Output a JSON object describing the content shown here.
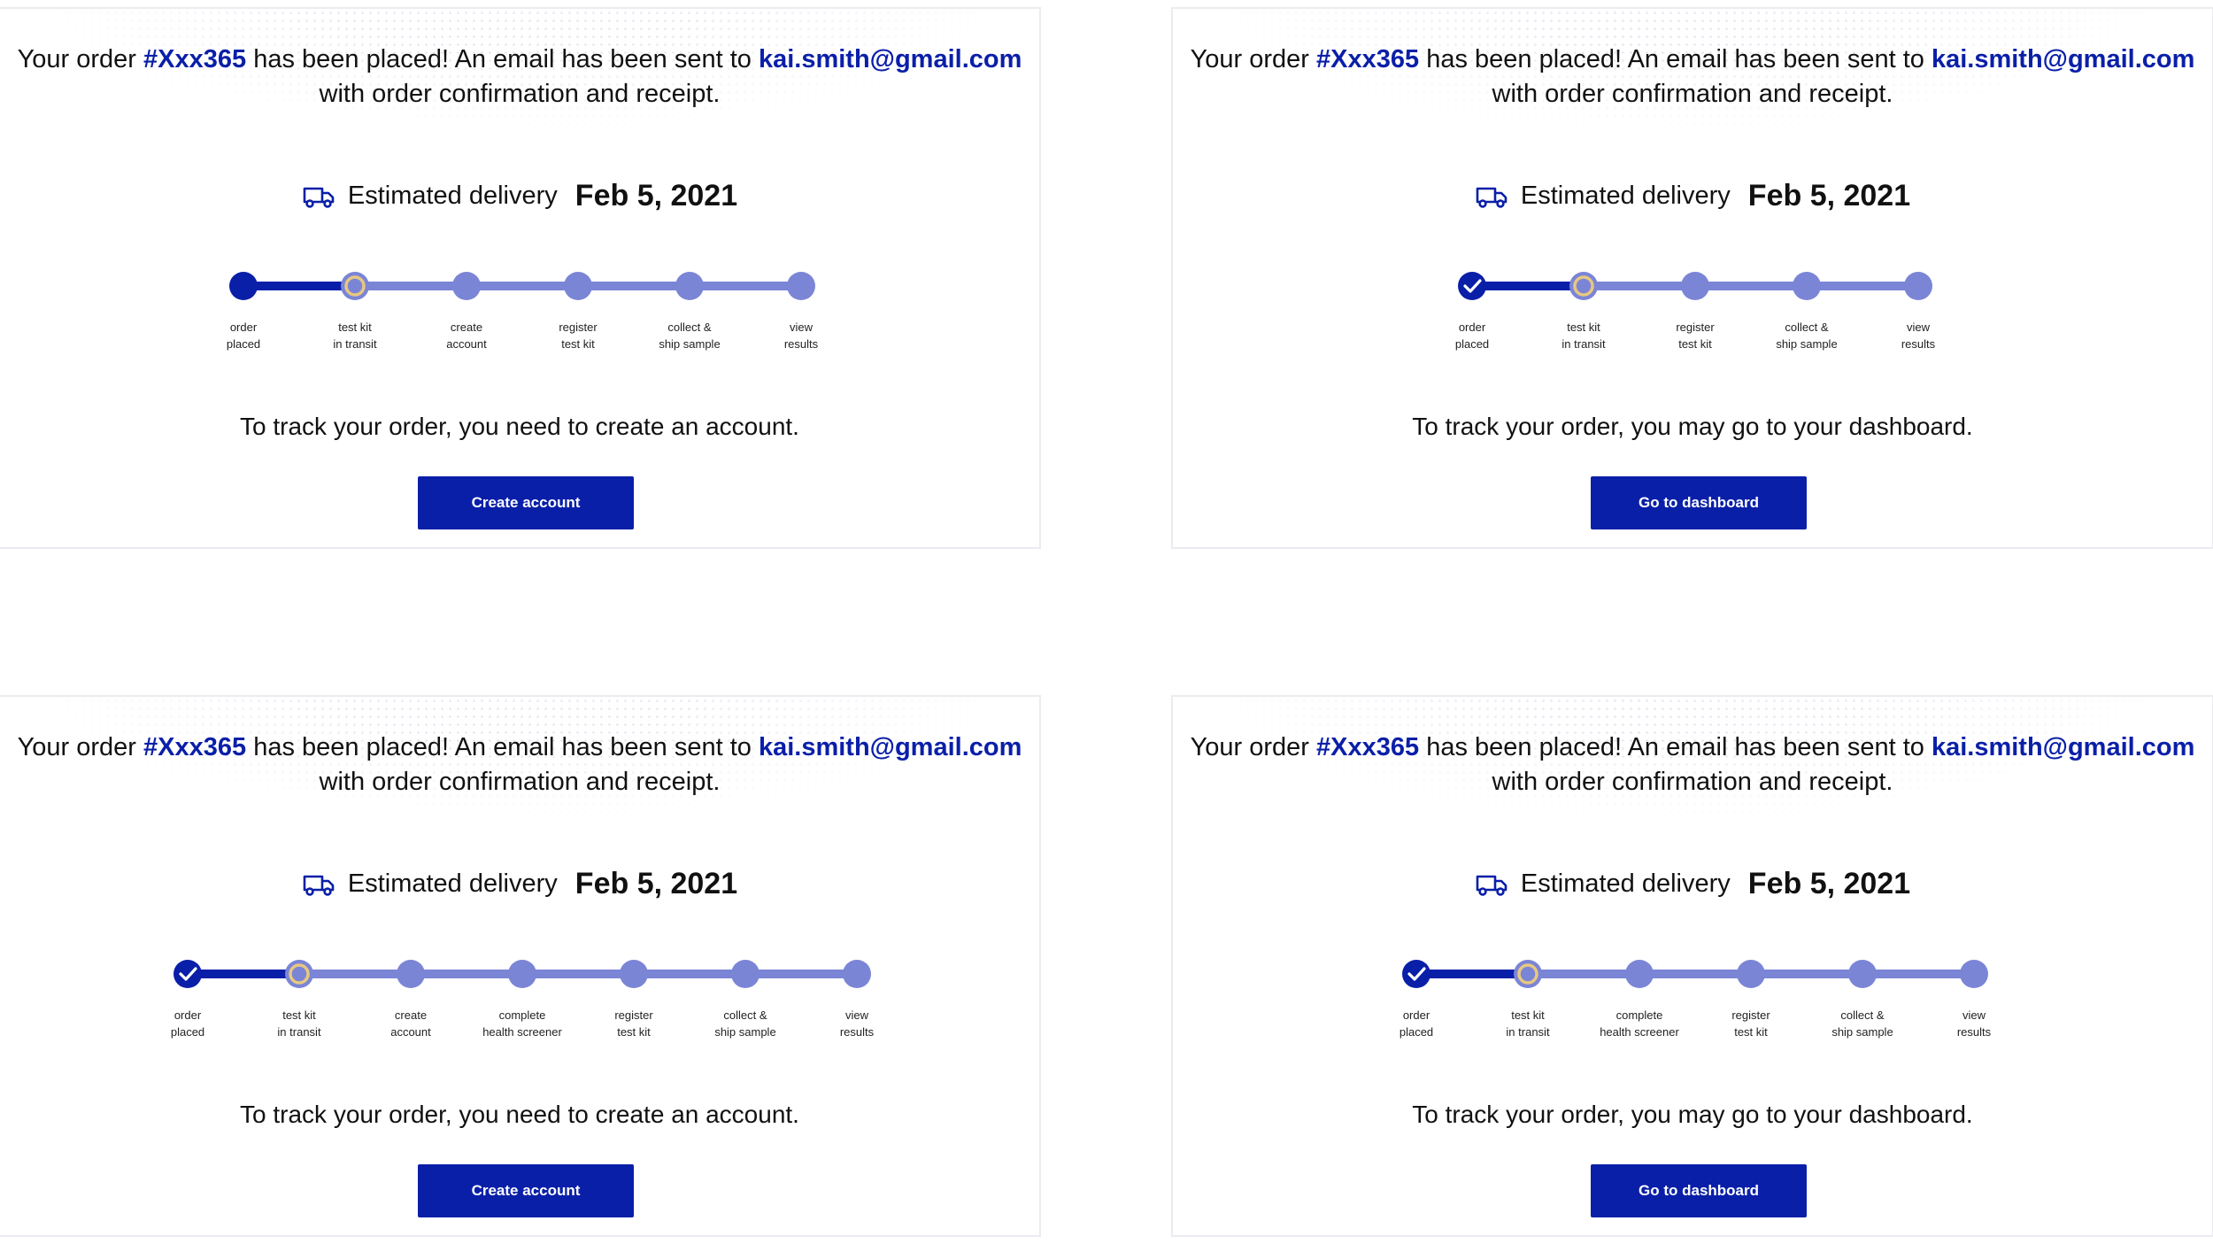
{
  "colors": {
    "accent": "#0a1fa8",
    "track_inactive": "#7b85d6",
    "current_ring": "#e8c880"
  },
  "cards": [
    {
      "message": {
        "prefix": "Your order",
        "order_id": "#Xxx365",
        "middle": "has been placed! An email has been sent to",
        "email": "kai.smith@gmail.com",
        "line2": "with order confirmation and receipt."
      },
      "delivery": {
        "icon": "truck-icon",
        "label": "Estimated delivery",
        "date": "Feb 5, 2021"
      },
      "first_step_checked": false,
      "current_step": 1,
      "steps": [
        {
          "line1": "order",
          "line2": "placed"
        },
        {
          "line1": "test kit",
          "line2": "in transit"
        },
        {
          "line1": "create",
          "line2": "account"
        },
        {
          "line1": "register",
          "line2": "test kit"
        },
        {
          "line1": "collect &",
          "line2": "ship sample"
        },
        {
          "line1": "view",
          "line2": "results"
        }
      ],
      "note": "To track your order, you need to create an account.",
      "button": "Create account"
    },
    {
      "message": {
        "prefix": "Your order",
        "order_id": "#Xxx365",
        "middle": "has been placed! An email has been sent to",
        "email": "kai.smith@gmail.com",
        "line2": "with order confirmation and receipt."
      },
      "delivery": {
        "icon": "truck-icon",
        "label": "Estimated delivery",
        "date": "Feb 5, 2021"
      },
      "first_step_checked": true,
      "current_step": 1,
      "steps": [
        {
          "line1": "order",
          "line2": "placed"
        },
        {
          "line1": "test kit",
          "line2": "in transit"
        },
        {
          "line1": "register",
          "line2": "test kit"
        },
        {
          "line1": "collect &",
          "line2": "ship sample"
        },
        {
          "line1": "view",
          "line2": "results"
        }
      ],
      "note": "To track your order, you may go to your dashboard.",
      "button": "Go to dashboard"
    },
    {
      "message": {
        "prefix": "Your order",
        "order_id": "#Xxx365",
        "middle": "has been placed! An email has been sent to",
        "email": "kai.smith@gmail.com",
        "line2": "with order confirmation and receipt."
      },
      "delivery": {
        "icon": "truck-icon",
        "label": "Estimated delivery",
        "date": "Feb 5, 2021"
      },
      "first_step_checked": true,
      "current_step": 1,
      "steps": [
        {
          "line1": "order",
          "line2": "placed"
        },
        {
          "line1": "test kit",
          "line2": "in transit"
        },
        {
          "line1": "create",
          "line2": "account"
        },
        {
          "line1": "complete",
          "line2": "health screener"
        },
        {
          "line1": "register",
          "line2": "test kit"
        },
        {
          "line1": "collect &",
          "line2": "ship sample"
        },
        {
          "line1": "view",
          "line2": "results"
        }
      ],
      "note": "To track your order, you need to create an account.",
      "button": "Create account"
    },
    {
      "message": {
        "prefix": "Your order",
        "order_id": "#Xxx365",
        "middle": "has been placed! An email has been sent to",
        "email": "kai.smith@gmail.com",
        "line2": "with order confirmation and receipt."
      },
      "delivery": {
        "icon": "truck-icon",
        "label": "Estimated delivery",
        "date": "Feb 5, 2021"
      },
      "first_step_checked": true,
      "current_step": 1,
      "steps": [
        {
          "line1": "order",
          "line2": "placed"
        },
        {
          "line1": "test kit",
          "line2": "in transit"
        },
        {
          "line1": "complete",
          "line2": "health screener"
        },
        {
          "line1": "register",
          "line2": "test kit"
        },
        {
          "line1": "collect &",
          "line2": "ship sample"
        },
        {
          "line1": "view",
          "line2": "results"
        }
      ],
      "note": "To track your order, you may go to your dashboard.",
      "button": "Go to dashboard"
    }
  ]
}
